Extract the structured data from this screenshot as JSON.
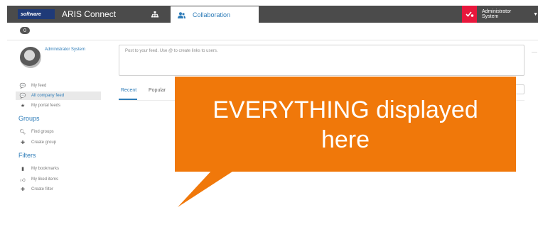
{
  "header": {
    "brand": "software",
    "app_name": "ARIS Connect",
    "collab_tab_label": "Collaboration",
    "user_name": "Administrator System"
  },
  "badge": {
    "count": "0"
  },
  "profile": {
    "name": "Administrator System"
  },
  "sidebar": {
    "feeds": [
      {
        "label": "My feed",
        "icon": "comments-icon"
      },
      {
        "label": "All company feed",
        "icon": "comments-icon",
        "active": true
      },
      {
        "label": "My portal feeds",
        "icon": "star-icon"
      }
    ],
    "groups_heading": "Groups",
    "groups": [
      {
        "label": "Find groups",
        "icon": "search-icon"
      },
      {
        "label": "Create group",
        "icon": "plus-icon"
      }
    ],
    "filters_heading": "Filters",
    "filters": [
      {
        "label": "My bookmarks",
        "icon": "bookmark-icon"
      },
      {
        "label": "My liked items",
        "icon": "thumbs-up-icon"
      },
      {
        "label": "Create filter",
        "icon": "plus-icon"
      }
    ]
  },
  "feed": {
    "post_placeholder": "Post to your feed. Use @ to create links to users.",
    "tabs": [
      {
        "label": "Recent"
      },
      {
        "label": "Popular"
      }
    ]
  },
  "callout": {
    "line1": "EVERYTHING displayed",
    "line2": "here"
  },
  "colors": {
    "accent": "#2e7cb8",
    "callout": "#f0780a",
    "topbar": "#4b4b4b",
    "alert": "#e8173c"
  }
}
